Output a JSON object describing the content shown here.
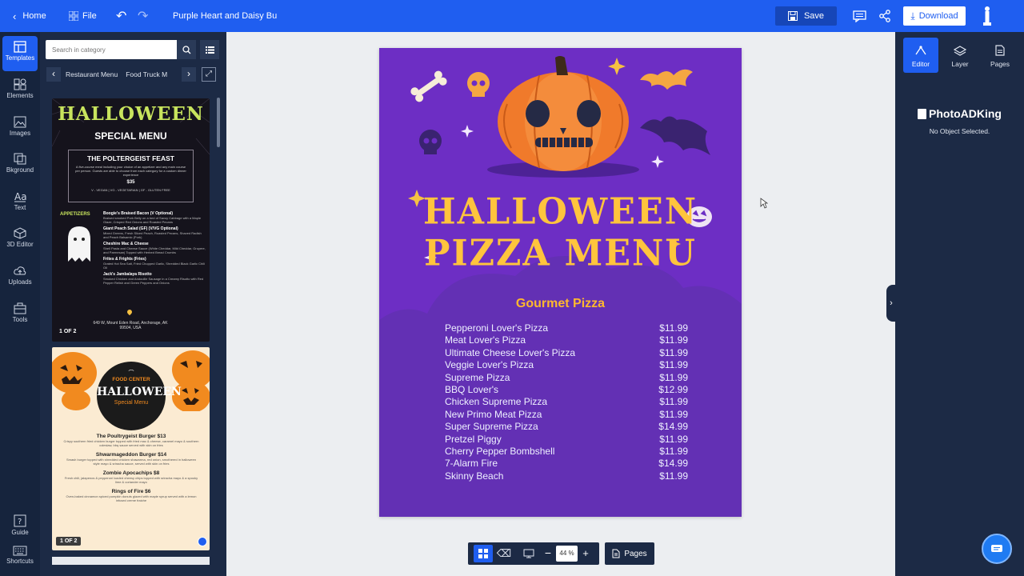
{
  "topbar": {
    "home": "Home",
    "file": "File",
    "doc_title": "Purple Heart and Daisy Bu",
    "save": "Save",
    "download": "Download"
  },
  "rail": [
    {
      "label": "Templates",
      "icon": "templates-icon"
    },
    {
      "label": "Elements",
      "icon": "elements-icon"
    },
    {
      "label": "Images",
      "icon": "images-icon"
    },
    {
      "label": "Bkground",
      "icon": "background-icon"
    },
    {
      "label": "Text",
      "icon": "text-icon"
    },
    {
      "label": "3D Editor",
      "icon": "3d-editor-icon"
    },
    {
      "label": "Uploads",
      "icon": "upload-icon"
    },
    {
      "label": "Tools",
      "icon": "tools-icon"
    }
  ],
  "rail_bottom": [
    {
      "label": "Guide",
      "icon": "guide-icon"
    },
    {
      "label": "Shortcuts",
      "icon": "keyboard-icon"
    }
  ],
  "panel": {
    "search_placeholder": "Search in category",
    "categories": [
      "Restaurant Menu",
      "Food Truck M"
    ],
    "thumb1": {
      "title": "HALLOWEEN",
      "subtitle": "SPECIAL MENU",
      "feast": "THE POLTERGEIST FEAST",
      "feast_desc": "A five-course meal including your choice of an appetizer and any main course per person. Guests are able to choose from each category for a custom dinner experience",
      "price": "$35",
      "legend": "V - VEGAN | VG - VEGETARIAN | GF - GLUTEN FREE",
      "section": "APPETIZERS",
      "items": [
        {
          "name": "Boogie's Braised Bacon (V Optional)",
          "desc": "Braised smoked Pork Belly on a bed of Savoy Cabbage with a Maple Glaze, Crisped Red Onions and Roasted Pecans"
        },
        {
          "name": "Giant Peach Salad (GF) (V/VG Optional)",
          "desc": "Mixed Greens, Fresh Sliced Peach, Roasted Pecans, Shaved Radish and Peach Balsamic (Pork)"
        },
        {
          "name": "Cheshire Mac & Cheese",
          "desc": "Shell Pasta and Cheese Sauce (White Cheddar, Mild Cheddar, Gruyere, and Parmesan) Topped with Herbed Bread Crumbs"
        },
        {
          "name": "Frites & Frights (Fries)",
          "desc": "Grated Hot Sea Salt, Fried Chopped Garlic, Shredded Black Garlic Chili Oil"
        },
        {
          "name": "Jack's Jambalaya Risotto",
          "desc": "Smoked Chicken and Andouille Sausage in a Creamy Risotto with Red Pepper Relish and Green Peppers and Onions"
        }
      ],
      "address": "649 W, Mount Eden Road, Anchorage, AK 99504, USA",
      "pager": "1 OF 2"
    },
    "thumb2": {
      "brand": "FOOD CENTER",
      "title": "HALLOWEEN",
      "subtitle": "Special Menu",
      "items": [
        {
          "name": "The Poultrygeist Burger $13",
          "desc": "Crispy southern fried chicken burger topped with fried mac & cheese, caramel mayo & southern coleslaw, bbq sauce served with skin on fries"
        },
        {
          "name": "Shwarmageddon Burger $14",
          "desc": "Smash burger topped with shredded chicken shawarma, red onion, smothered in halloween style mayo & sriracha sauce, served with skin on fries"
        },
        {
          "name": "Zombie Apocachips $8",
          "desc": "Fresh chili, jalapenos & pepperoni loaded cheesy chips topped with sriracha mayo & a spooky lime & coriander mayo"
        },
        {
          "name": "Rings of Fire $6",
          "desc": "Oven-baked cinnamon spiced pumpkin donuts glazed with maple syrup served with a lemon infused creme fraiche"
        }
      ],
      "pager": "1 OF 2"
    }
  },
  "design": {
    "title_line1": "HALLOWEEN",
    "title_line2": "PIZZA MENU",
    "section": "Gourmet Pizza",
    "items": [
      {
        "name": "Pepperoni Lover's Pizza",
        "price": "$11.99"
      },
      {
        "name": "Meat Lover's Pizza",
        "price": "$11.99"
      },
      {
        "name": "Ultimate Cheese Lover's Pizza",
        "price": "$11.99"
      },
      {
        "name": "Veggie Lover's Pizza",
        "price": "$11.99"
      },
      {
        "name": "Supreme Pizza",
        "price": "$11.99"
      },
      {
        "name": "BBQ Lover's",
        "price": "$12.99"
      },
      {
        "name": "Chicken Supreme Pizza",
        "price": "$11.99"
      },
      {
        "name": "New Primo Meat Pizza",
        "price": "$11.99"
      },
      {
        "name": "Super Supreme Pizza",
        "price": "$14.99"
      },
      {
        "name": "Pretzel Piggy",
        "price": "$11.99"
      },
      {
        "name": "Cherry Pepper Bombshell",
        "price": "$11.99"
      },
      {
        "name": "7-Alarm Fire",
        "price": "$14.99"
      },
      {
        "name": "Skinny Beach",
        "price": "$11.99"
      }
    ],
    "colors": {
      "background": "#6d2ec4",
      "title": "#ffc43d",
      "pumpkin": "#f07a2b"
    }
  },
  "bottombar": {
    "zoom": "44 %",
    "pages": "Pages"
  },
  "rpanel": {
    "tabs": [
      "Editor",
      "Layer",
      "Pages"
    ],
    "brand": "PhotoADKing",
    "status": "No Object Selected."
  }
}
